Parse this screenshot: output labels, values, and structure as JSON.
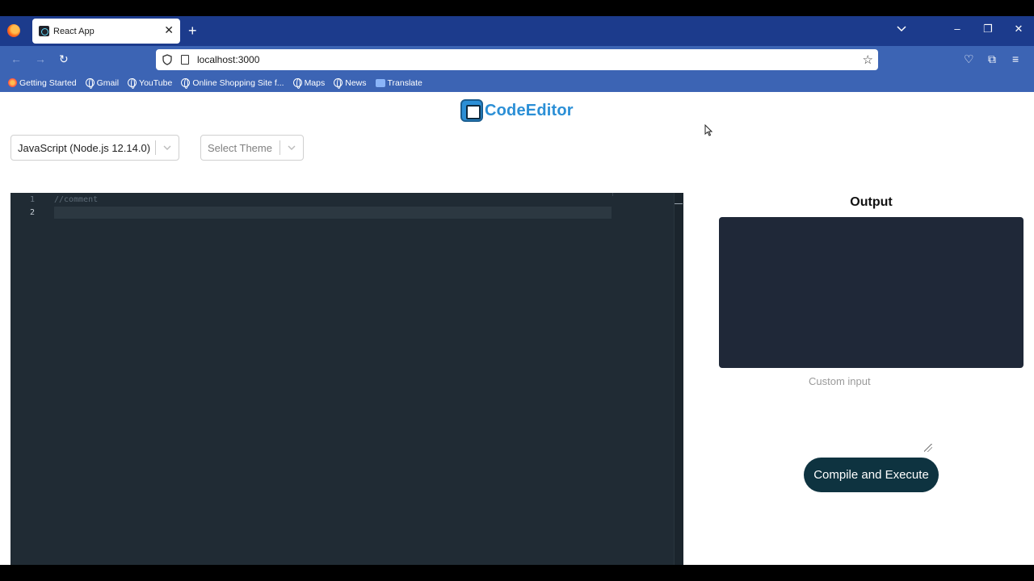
{
  "browser": {
    "tab_title": "React App",
    "tab_close": "✕",
    "new_tab": "+",
    "url": "localhost:3000",
    "bookmarks": [
      {
        "label": "Getting Started",
        "icon": "firefox-icon"
      },
      {
        "label": "Gmail",
        "icon": "globe-icon"
      },
      {
        "label": "YouTube",
        "icon": "globe-icon"
      },
      {
        "label": "Online Shopping Site f...",
        "icon": "globe-icon"
      },
      {
        "label": "Maps",
        "icon": "globe-icon"
      },
      {
        "label": "News",
        "icon": "globe-icon"
      },
      {
        "label": "Translate",
        "icon": "translate-icon"
      }
    ]
  },
  "app": {
    "logo_text": "CodeEditor",
    "language_select": {
      "value": "JavaScript (Node.js 12.14.0)"
    },
    "theme_select": {
      "placeholder": "Select Theme"
    },
    "editor": {
      "line_numbers": [
        "1",
        "2"
      ],
      "lines": [
        "//comment",
        ""
      ]
    },
    "output": {
      "title": "Output",
      "content": ""
    },
    "custom_input": {
      "placeholder": "Custom input"
    },
    "compile_button": "Compile and Execute"
  },
  "colors": {
    "tab_strip": "#1c3b8c",
    "toolbar": "#3c64b4",
    "editor_bg": "#202b34",
    "output_bg": "#1f2838",
    "button_bg": "#0e3340",
    "logo": "#2b8fd6"
  }
}
